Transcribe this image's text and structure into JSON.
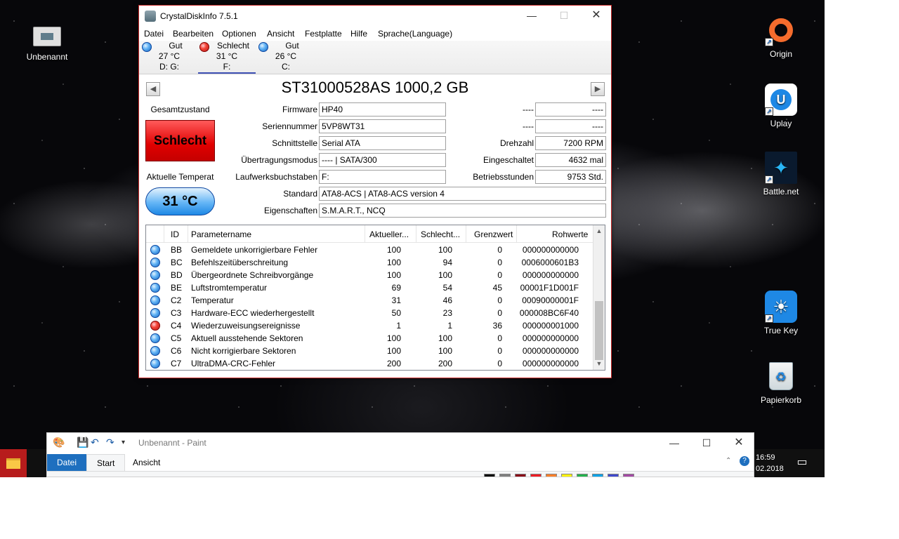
{
  "desktop": {
    "icons": [
      {
        "label": "Unbenannt",
        "icon": "image-file-icon"
      },
      {
        "label": "Origin",
        "icon": "origin-icon"
      },
      {
        "label": "Uplay",
        "icon": "uplay-icon"
      },
      {
        "label": "Battle.net",
        "icon": "battlenet-icon"
      },
      {
        "label": "True Key",
        "icon": "truekey-icon"
      },
      {
        "label": "Papierkorb",
        "icon": "recycle-bin-icon"
      }
    ]
  },
  "cdi": {
    "title": "CrystalDiskInfo 7.5.1",
    "menu": [
      "Datei",
      "Bearbeiten",
      "Optionen",
      "Ansicht",
      "Festplatte",
      "Hilfe",
      "Sprache(Language)"
    ],
    "drives": [
      {
        "status": "Gut",
        "temp": "27 °C",
        "letter": "D: G:",
        "color": "#1e88e5"
      },
      {
        "status": "Schlecht",
        "temp": "31 °C",
        "letter": "F:",
        "color": "#e53935"
      },
      {
        "status": "Gut",
        "temp": "26 °C",
        "letter": "C:",
        "color": "#1e88e5"
      }
    ],
    "model": "ST31000528AS 1000,2 GB",
    "health_label": "Gesamtzustand",
    "health_value": "Schlecht",
    "temp_label": "Aktuelle Temperat",
    "temp_value": "31 °C",
    "fields": {
      "firmware_label": "Firmware",
      "firmware": "HP40",
      "serial_label": "Seriennummer",
      "serial": "5VP8WT31",
      "interface_label": "Schnittstelle",
      "interface": "Serial ATA",
      "transfer_label": "Übertragungsmodus",
      "transfer": "---- | SATA/300",
      "letters_label": "Laufwerksbuchstaben",
      "letters": "F:",
      "standard_label": "Standard",
      "standard": "ATA8-ACS | ATA8-ACS version 4",
      "features_label": "Eigenschaften",
      "features": "S.M.A.R.T., NCQ",
      "r1_label": "----",
      "r1": "----",
      "r2_label": "----",
      "r2": "----",
      "rpm_label": "Drehzahl",
      "rpm": "7200 RPM",
      "poweron_count_label": "Eingeschaltet",
      "poweron_count": "4632 mal",
      "hours_label": "Betriebsstunden",
      "hours": "9753 Std."
    },
    "smart": {
      "headers": [
        "ID",
        "Parametername",
        "Aktueller...",
        "Schlecht...",
        "Grenzwert",
        "Rohwerte"
      ],
      "rows": [
        {
          "id": "BB",
          "name": "Gemeldete unkorrigierbare Fehler",
          "cur": "100",
          "worst": "100",
          "thr": "0",
          "raw": "000000000000",
          "state": "blue"
        },
        {
          "id": "BC",
          "name": "Befehlszeitüberschreitung",
          "cur": "100",
          "worst": "94",
          "thr": "0",
          "raw": "0006000601B3",
          "state": "blue"
        },
        {
          "id": "BD",
          "name": "Übergeordnete Schreibvorgänge",
          "cur": "100",
          "worst": "100",
          "thr": "0",
          "raw": "000000000000",
          "state": "blue"
        },
        {
          "id": "BE",
          "name": "Luftstromtemperatur",
          "cur": "69",
          "worst": "54",
          "thr": "45",
          "raw": "00001F1D001F",
          "state": "blue"
        },
        {
          "id": "C2",
          "name": "Temperatur",
          "cur": "31",
          "worst": "46",
          "thr": "0",
          "raw": "00090000001F",
          "state": "blue"
        },
        {
          "id": "C3",
          "name": "Hardware-ECC wiederhergestellt",
          "cur": "50",
          "worst": "23",
          "thr": "0",
          "raw": "000008BC6F40",
          "state": "blue"
        },
        {
          "id": "C4",
          "name": "Wiederzuweisungsereignisse",
          "cur": "1",
          "worst": "1",
          "thr": "36",
          "raw": "000000001000",
          "state": "red"
        },
        {
          "id": "C5",
          "name": "Aktuell ausstehende Sektoren",
          "cur": "100",
          "worst": "100",
          "thr": "0",
          "raw": "000000000000",
          "state": "blue"
        },
        {
          "id": "C6",
          "name": "Nicht korrigierbare Sektoren",
          "cur": "100",
          "worst": "100",
          "thr": "0",
          "raw": "000000000000",
          "state": "blue"
        },
        {
          "id": "C7",
          "name": "UltraDMA-CRC-Fehler",
          "cur": "200",
          "worst": "200",
          "thr": "0",
          "raw": "000000000000",
          "state": "blue"
        }
      ]
    }
  },
  "paint": {
    "title": "Unbenannt - Paint",
    "tabs": [
      "Datei",
      "Start",
      "Ansicht"
    ]
  },
  "taskbar": {
    "time": "16:59",
    "date": "02.2018"
  }
}
